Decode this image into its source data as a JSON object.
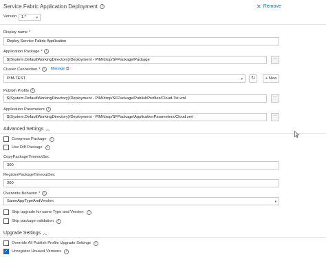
{
  "header": {
    "title": "Service Fabric Application Deployment",
    "remove_label": "Remove"
  },
  "version": {
    "label": "Version",
    "value": "1.*"
  },
  "display_name": {
    "label": "Display name",
    "value": "Deploy Service Fabric Application"
  },
  "application_package": {
    "label": "Application Package",
    "value": "$(System.DefaultWorkingDirectory)/Deployment - PIM/drop/SFPackage/Package"
  },
  "cluster_connection": {
    "label": "Cluster Connection",
    "manage_label": "Manage",
    "value": "PIM-TEST",
    "new_label": "+ New"
  },
  "publish_profile": {
    "label": "Publish Profile",
    "value": "$(System.DefaultWorkingDirectory)/Deployment - PIM/drop/SFPackage/PublishProfiles/Cloud-Tst.xml"
  },
  "application_parameters": {
    "label": "Application Parameters",
    "value": "$(System.DefaultWorkingDirectory)/Deployment - PIM/drop/SFPackage/ApplicationParameters/Cloud.xml"
  },
  "advanced": {
    "title": "Advanced Settings",
    "compress_package": {
      "label": "Compress Package",
      "checked": false
    },
    "use_diff_package": {
      "label": "Use Diff Package",
      "checked": false
    },
    "copy_timeout": {
      "label": "CopyPackageTimeoutSec",
      "value": "300"
    },
    "register_timeout": {
      "label": "RegisterPackageTimeoutSec",
      "value": "300"
    },
    "overwrite_behavior": {
      "label": "Overwrite Behavior",
      "value": "SameAppTypeAndVersion"
    },
    "skip_upgrade": {
      "label": "Skip upgrade for same Type and Version",
      "checked": false
    },
    "skip_validation": {
      "label": "Skip package validation",
      "checked": false
    }
  },
  "upgrade": {
    "title": "Upgrade Settings",
    "override_all": {
      "label": "Override All Publish Profile Upgrade Settings",
      "checked": false
    },
    "unregister_unused": {
      "label": "Unregister Unused Versions",
      "checked": true
    }
  },
  "colors": {
    "link": "#106ebe",
    "border": "#c8c8c8"
  }
}
